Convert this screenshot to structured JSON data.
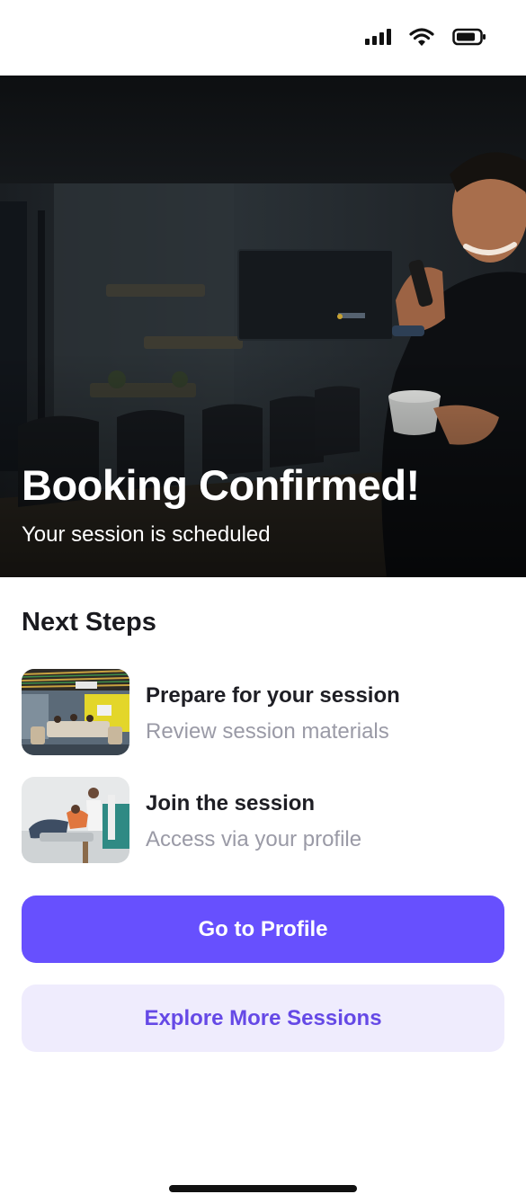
{
  "status_bar": {
    "icons": [
      "signal-icon",
      "wifi-icon",
      "battery-icon"
    ]
  },
  "hero": {
    "title": "Booking Confirmed!",
    "subtitle": "Your session is scheduled"
  },
  "next_steps": {
    "heading": "Next Steps",
    "items": [
      {
        "title": "Prepare for your session",
        "subtitle": "Review session materials"
      },
      {
        "title": "Join the session",
        "subtitle": "Access via your profile"
      }
    ]
  },
  "actions": {
    "primary_label": "Go to Profile",
    "secondary_label": "Explore More Sessions"
  },
  "colors": {
    "accent": "#6750fe",
    "accent_soft": "#efecfd",
    "accent_text": "#6549e6",
    "muted_text": "#9a9aa6"
  }
}
